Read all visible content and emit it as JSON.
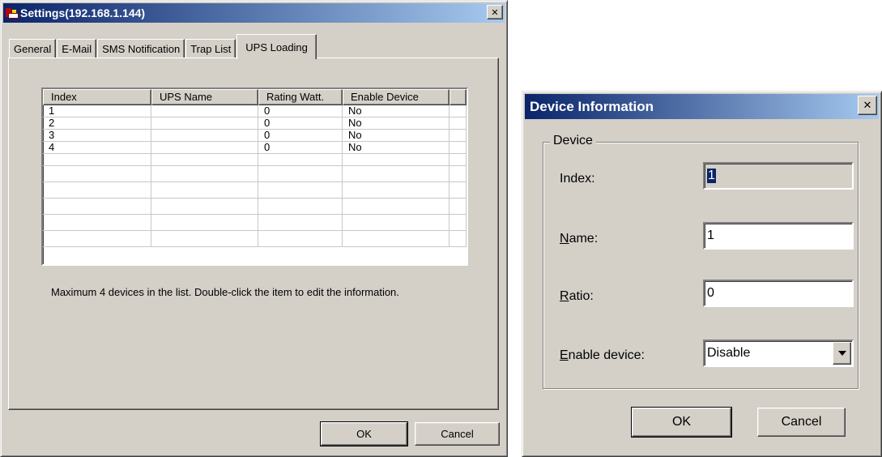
{
  "settings": {
    "title": "Settings(192.168.1.144)",
    "close_glyph": "✕",
    "tabs": [
      {
        "label": "General"
      },
      {
        "label": "E-Mail"
      },
      {
        "label": "SMS Notification"
      },
      {
        "label": "Trap List"
      },
      {
        "label": "UPS Loading",
        "active": true
      }
    ],
    "table": {
      "columns": [
        "Index",
        "UPS Name",
        "Rating Watt.",
        "Enable Device"
      ],
      "rows": [
        [
          "1",
          "",
          "0",
          "No"
        ],
        [
          "2",
          "",
          "0",
          "No"
        ],
        [
          "3",
          "",
          "0",
          "No"
        ],
        [
          "4",
          "",
          "0",
          "No"
        ]
      ]
    },
    "info_text": "Maximum 4 devices in the list. Double-click the item to edit the information.",
    "ok_label": "OK",
    "cancel_label": "Cancel"
  },
  "device_dialog": {
    "title": "Device Information",
    "close_glyph": "✕",
    "group_label": "Device",
    "index_label": "Index:",
    "index_value": "1",
    "name_label_accel": "N",
    "name_label_rest": "ame:",
    "name_value": "1",
    "ratio_label_accel": "R",
    "ratio_label_rest": "atio:",
    "ratio_value": "0",
    "enable_label_accel": "E",
    "enable_label_rest": "nable device:",
    "enable_value": "Disable",
    "ok_label": "OK",
    "cancel_label": "Cancel"
  },
  "colors": {
    "titlebar_start": "#0a246a",
    "titlebar_end": "#a6caf0",
    "face": "#d4d0c8"
  }
}
